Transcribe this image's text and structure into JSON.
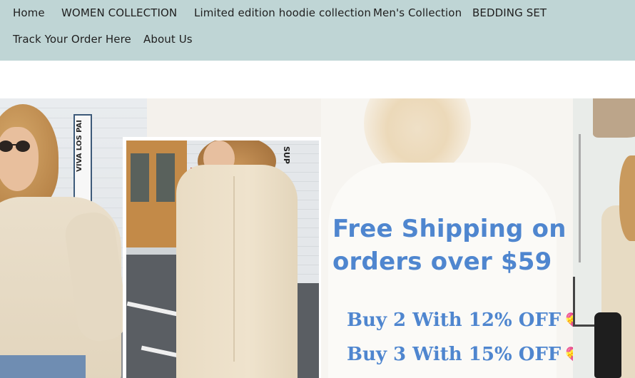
{
  "nav": {
    "row1": [
      "Home",
      "WOMEN COLLECTION",
      "Limited edition hoodie collection",
      "Men's Collection",
      "BEDDING SET"
    ],
    "row2": [
      "Track Your Order Here",
      "About Us"
    ]
  },
  "banner": {
    "headline": "Free Shipping on orders over $59",
    "promo1": "Buy 2 With 12% OFF",
    "promo2": "Buy 3 With 15% OFF",
    "left_sign_text": "VIVA LOS PAI",
    "mid_sign_text": "SUP"
  },
  "colors": {
    "nav_bg": "#bfd5d5",
    "promo_blue": "#4f86cf"
  },
  "icons": {
    "promo_heart": "heart-with-ribbon-icon"
  }
}
